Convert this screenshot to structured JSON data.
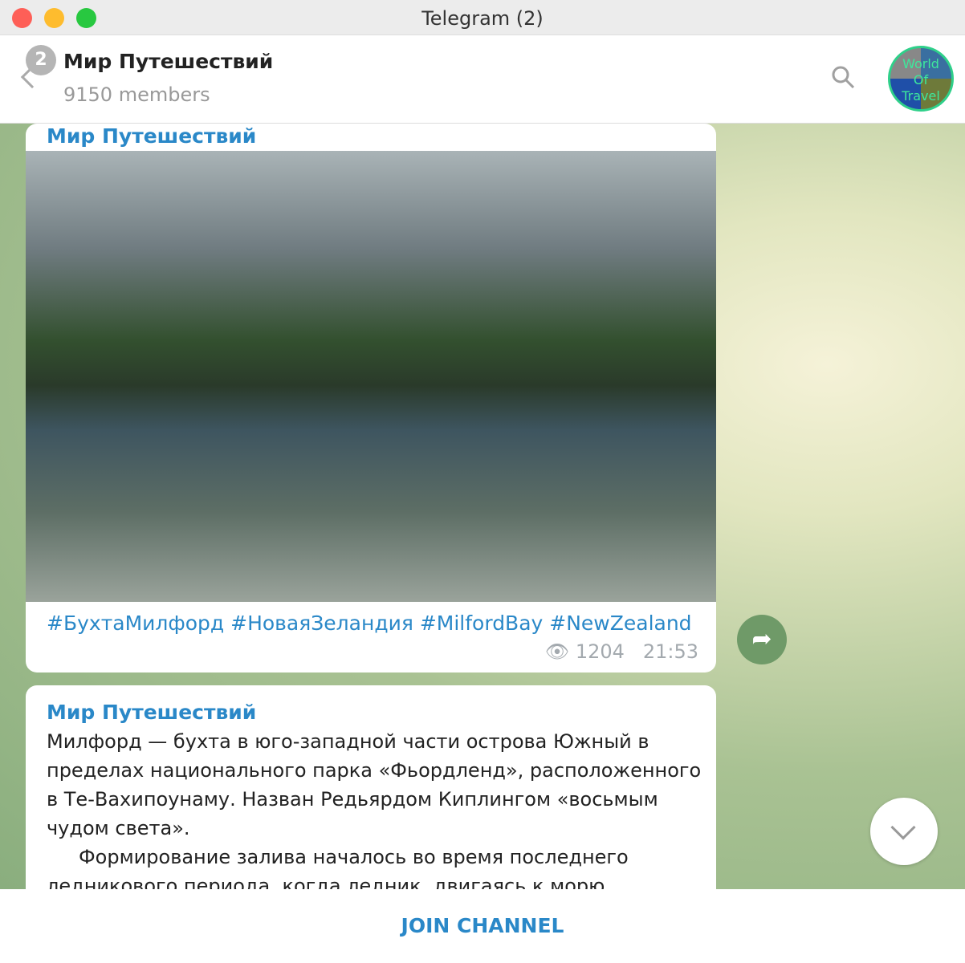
{
  "window": {
    "title": "Telegram (2)"
  },
  "header": {
    "unread_badge": "2",
    "channel_name": "Мир Путешествий",
    "members": "9150 members",
    "avatar_text": [
      "World",
      "Of",
      "Travel"
    ]
  },
  "messages": [
    {
      "sender": "Мир Путешествий",
      "hashtags": "#БухтаМилфорд #НоваяЗеландия #MilfordBay #NewZealand",
      "views": "1204",
      "time": "21:53"
    },
    {
      "sender": "Мир Путешествий",
      "paragraph1": "Милфорд — бухта в юго-западной части острова Южный в пределах национального парка «Фьордленд», расположенного в Те-Вахипоунаму. Назван Редьярдом Киплингом «восьмым чудом света».",
      "paragraph2": "Формирование залива началось во время последнего ледникового периода, когда ледник, двигаясь к морю, выдавил"
    }
  ],
  "footer": {
    "join_label": "JOIN CHANNEL"
  },
  "colors": {
    "accent": "#2a88c8",
    "forward_button": "#6f9a68"
  }
}
